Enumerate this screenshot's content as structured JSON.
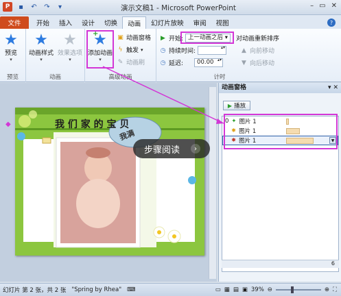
{
  "window": {
    "title": "演示文稿1 - Microsoft PowerPoint",
    "qat": [
      "save-icon",
      "undo-icon",
      "redo-icon",
      "customize-icon"
    ]
  },
  "tabs": [
    {
      "label": "文件"
    },
    {
      "label": "开始"
    },
    {
      "label": "插入"
    },
    {
      "label": "设计"
    },
    {
      "label": "切换"
    },
    {
      "label": "动画"
    },
    {
      "label": "幻灯片放映"
    },
    {
      "label": "审阅"
    },
    {
      "label": "视图"
    }
  ],
  "ribbon": {
    "preview": {
      "button": "预览",
      "group": "预览"
    },
    "animation": {
      "styles": "动画样式",
      "effects": "效果选项",
      "group": "动画"
    },
    "advanced": {
      "add_animation": "添加动画",
      "animation_pane": "动画窗格",
      "trigger": "触发",
      "animation_painter": "动画刷",
      "group": "高级动画"
    },
    "timing": {
      "start_label": "开始:",
      "start_value": "上一动画之后",
      "duration_label": "持续时间:",
      "delay_label": "延迟:",
      "delay_value": "00.00",
      "reorder": "对动画重新排序",
      "move_earlier": "向前移动",
      "move_later": "向后移动",
      "group": "计时"
    }
  },
  "slide": {
    "title": "我 们 家 的 宝 贝",
    "bubble": "我满"
  },
  "pane": {
    "title": "动画窗格",
    "play": "播放",
    "items": [
      {
        "index": "0",
        "name": "图片 1"
      },
      {
        "index": "",
        "name": "图片 1"
      },
      {
        "index": "",
        "name": "图片 1"
      }
    ],
    "timeline_label": "6"
  },
  "status": {
    "slide_info": "幻灯片 第 2 张，共 2 张",
    "theme": "\"Spring by Rhea\"",
    "zoom": "39%"
  },
  "overlay": {
    "label": "步骤阅读"
  },
  "colors": {
    "highlight": "#d336d6",
    "file_tab": "#cf4b1c",
    "slide_green": "#8cc63f"
  }
}
